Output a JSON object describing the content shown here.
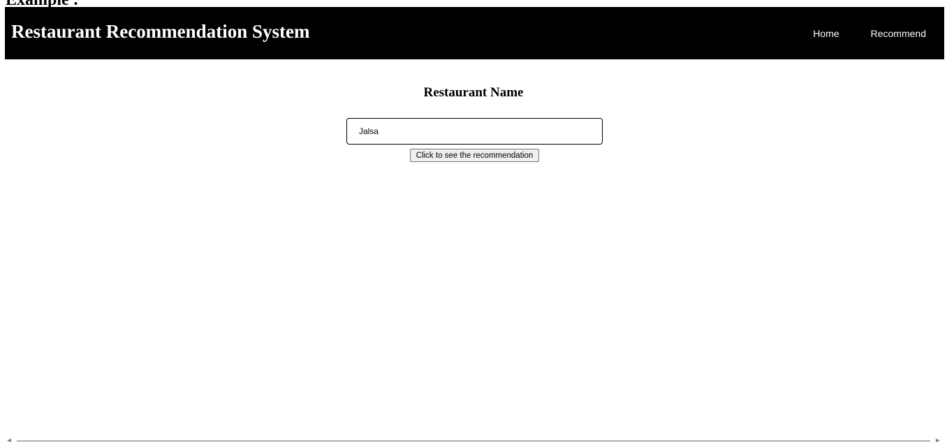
{
  "caption": "Example :",
  "navbar": {
    "brand": "Restaurant Recommendation System",
    "links": [
      {
        "label": "Home"
      },
      {
        "label": "Recommend"
      }
    ]
  },
  "form": {
    "heading": "Restaurant Name",
    "input_value": "Jalsa",
    "button_label": "Click to see the recommendation"
  },
  "scrollbar": {
    "left_arrow_icon": "arrow-left-icon",
    "right_arrow_icon": "arrow-right-icon"
  },
  "colors": {
    "navbar_background": "#000000",
    "navbar_text": "#ffffff",
    "page_background": "#ffffff"
  }
}
